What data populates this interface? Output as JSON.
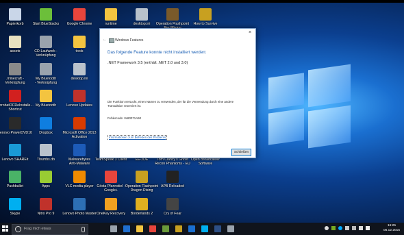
{
  "desktop": {
    "icons": [
      {
        "label": "Papierkorb",
        "icon": "recycle-bin-icon",
        "color": "#c9d6e8"
      },
      {
        "label": "Start BlueStacks",
        "icon": "bluestacks-icon",
        "color": "#6cbf3a"
      },
      {
        "label": "Google Chrome",
        "icon": "chrome-icon",
        "color": "#e8453c"
      },
      {
        "label": "runtime",
        "icon": "folder-icon",
        "color": "#f3c440"
      },
      {
        "label": "desktop.ini",
        "icon": "file-icon",
        "color": "#b9c2cc"
      },
      {
        "label": "Operation Flashpoint\nRed Rising",
        "icon": "game-icon",
        "color": "#7a5a2a"
      },
      {
        "label": "How to Survive",
        "icon": "game-icon",
        "color": "#c8a020"
      },
      {
        "label": "assets",
        "icon": "file-icon",
        "color": "#e8e0c0"
      },
      {
        "label": "CD-Laufwerk -\nVerknüpfung",
        "icon": "cd-drive-icon",
        "color": "#9aa3ad"
      },
      {
        "label": "tools",
        "icon": "folder-icon",
        "color": "#f3c440"
      },
      {
        "label": ".minecraft -\nVerknüpfung",
        "icon": "shortcut-icon",
        "color": "#8a8a8a"
      },
      {
        "label": "My Bluetooth\n- Verknüpfung",
        "icon": "shortcut-icon",
        "color": "#9aa3ad"
      },
      {
        "label": "desktop.ini",
        "icon": "file-icon",
        "color": "#b9c2cc"
      },
      {
        "label": "AcrobatDCReInstalle...\nShortcut",
        "icon": "acrobat-icon",
        "color": "#d2201f"
      },
      {
        "label": "My Bluetooth",
        "icon": "folder-icon",
        "color": "#f3c440"
      },
      {
        "label": "Lenovo Updates",
        "icon": "update-icon",
        "color": "#c0322b"
      },
      {
        "label": "Lenovo PowerDVD10",
        "icon": "dvd-icon",
        "color": "#2a2a2a"
      },
      {
        "label": "Dropbox",
        "icon": "dropbox-icon",
        "color": "#0f7ee0"
      },
      {
        "label": "Microsoft Office 2013\nActivation",
        "icon": "office-icon",
        "color": "#d83b01"
      },
      {
        "label": "Lenovo SHAREit",
        "icon": "shareit-icon",
        "color": "#1a9ad6"
      },
      {
        "label": "Thumbs.db",
        "icon": "file-icon",
        "color": "#b9c2cc"
      },
      {
        "label": "Malwarebytes\nAnti-Malware",
        "icon": "malwarebytes-icon",
        "color": "#1d5bb8"
      },
      {
        "label": "TeamSpeak 3 Client",
        "icon": "teamspeak-icon",
        "color": "#2d4f85"
      },
      {
        "label": "EE-2DE",
        "icon": "file-icon",
        "color": "#b9c2cc"
      },
      {
        "label": "Tom Clancy's Ghost\nRecon Phantoms - EU",
        "icon": "game-icon",
        "color": "#555"
      },
      {
        "label": "Open Broadcaster\nSoftware",
        "icon": "obs-icon",
        "color": "#333"
      },
      {
        "label": "Pushbullet",
        "icon": "pushbullet-icon",
        "color": "#4ab367"
      },
      {
        "label": "Apps",
        "icon": "android-icon",
        "color": "#9c3"
      },
      {
        "label": "VLC media player",
        "icon": "vlc-icon",
        "color": "#f08a00"
      },
      {
        "label": "Gösta Pfannstiel -\nGoogle+",
        "icon": "chrome-icon",
        "color": "#e8453c"
      },
      {
        "label": "Operation Flashpoint\nDragon Rising",
        "icon": "game-icon",
        "color": "#c8a020"
      },
      {
        "label": "APB Reloaded",
        "icon": "apb-icon",
        "color": "#222"
      },
      {
        "label": "Skype",
        "icon": "skype-icon",
        "color": "#00aff0"
      },
      {
        "label": "Nitro Pro 9",
        "icon": "nitro-icon",
        "color": "#c0322b"
      },
      {
        "label": "Lenovo Photo Master",
        "icon": "photo-icon",
        "color": "#2d6fb4"
      },
      {
        "label": "OneKey Recovery",
        "icon": "recovery-icon",
        "color": "#f0a020"
      },
      {
        "label": "Borderlands 2",
        "icon": "game-icon",
        "color": "#e0b020"
      },
      {
        "label": "Cry of Fear",
        "icon": "game-icon",
        "color": "#444"
      }
    ]
  },
  "dialog": {
    "caption": "Windows Features",
    "close_glyph": "×",
    "back_glyph": "←",
    "heading": "Das folgende Feature konnte nicht installiert werden:",
    "feature": ".NET Framework 3.5 (enthält .NET 2.0 und 3.0)",
    "message": "Die Funktion versucht, einen Namen zu verwenden, der für die Verwendung durch eine andere Transaktion reserviert ist.",
    "error_code": "Fehlercode: 0x80071A90",
    "help_link": "Informationen zum Beheben des Problems",
    "close_button": "Schließen"
  },
  "taskbar": {
    "search_placeholder": "Frag mich etwas",
    "time": "16:25",
    "date": "06.12.2015",
    "pinned": [
      {
        "icon": "task-view-icon",
        "color": "#9aa3ad"
      },
      {
        "icon": "edge-icon",
        "color": "#1f6fd0"
      },
      {
        "icon": "explorer-icon",
        "color": "#f3c440"
      },
      {
        "icon": "chrome-icon",
        "color": "#e8453c"
      },
      {
        "icon": "minecraft-icon",
        "color": "#6a9a3a"
      },
      {
        "icon": "game-icon",
        "color": "#c8a020"
      },
      {
        "icon": "store-icon",
        "color": "#1a6fd0"
      },
      {
        "icon": "skype-icon",
        "color": "#00aff0"
      },
      {
        "icon": "teamspeak-icon",
        "color": "#2d4f85"
      },
      {
        "icon": "windows-features-icon",
        "color": "#9aa3ad"
      }
    ]
  }
}
